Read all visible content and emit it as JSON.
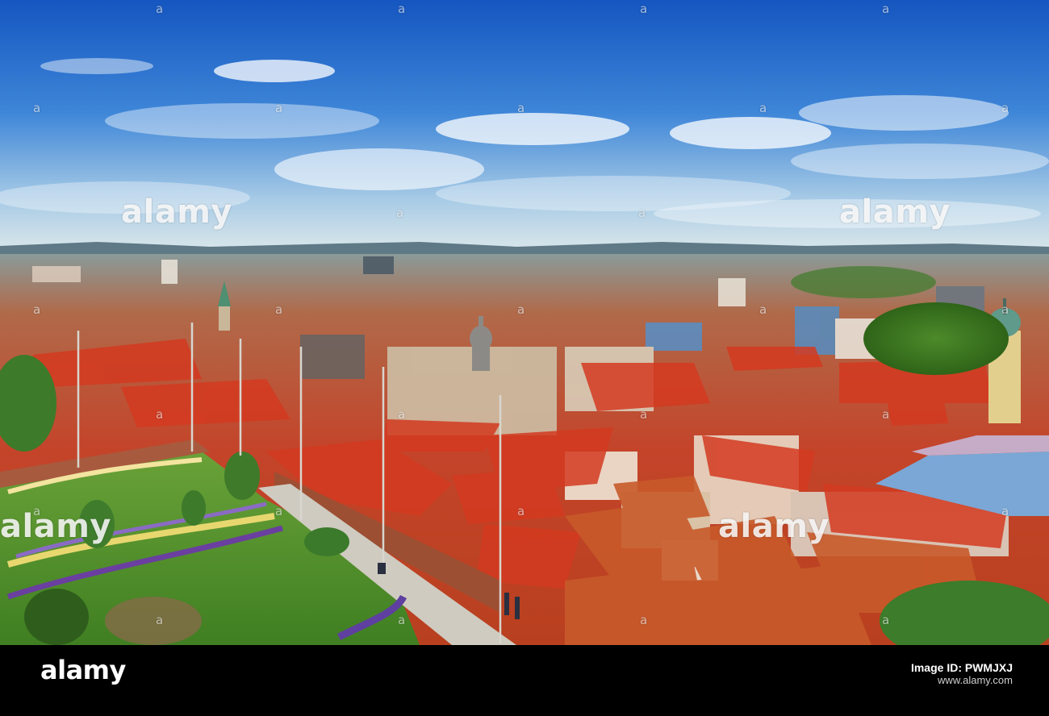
{
  "watermark": {
    "brand": "alamy",
    "mark": "a"
  },
  "footer": {
    "logo": "alamy",
    "image_id_label": "Image ID: PWMJXJ",
    "url": "www.alamy.com"
  },
  "colors": {
    "sky_top": "#1a63c8",
    "sky_horizon": "#cfe3ee",
    "roof_red": "#c8321e",
    "lawn_green": "#4e8f2c",
    "footer_bg": "#000000"
  }
}
